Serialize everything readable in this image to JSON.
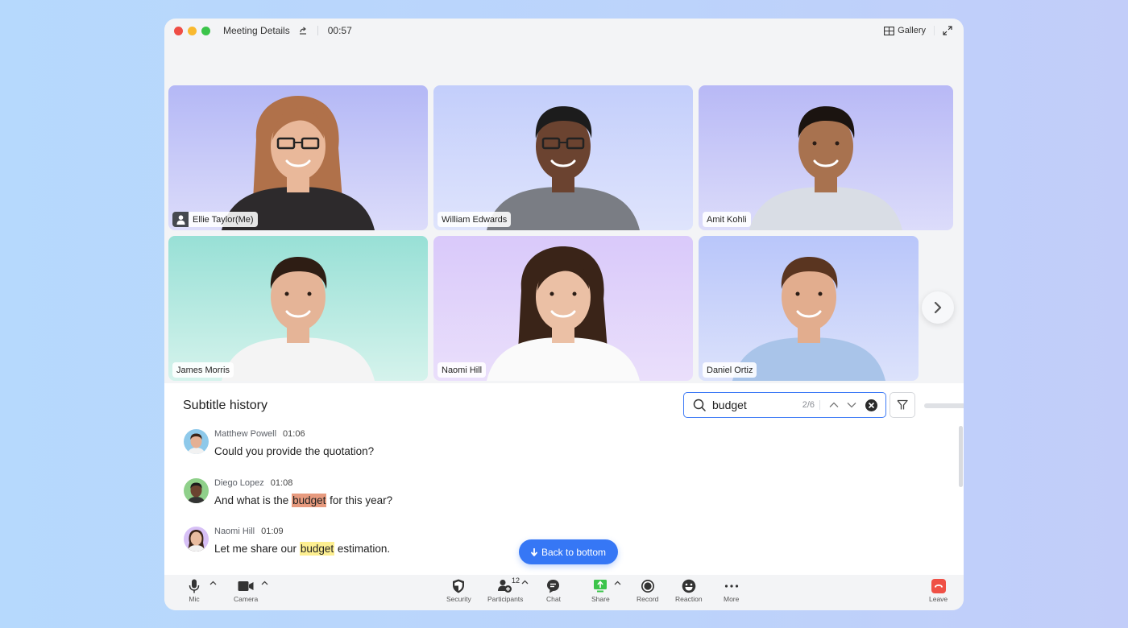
{
  "titlebar": {
    "title": "Meeting Details",
    "timer": "00:57",
    "view_label": "Gallery"
  },
  "participants": [
    {
      "name": "Ellie Taylor(Me)",
      "is_me": true,
      "bg_top": "#b4b8f6",
      "bg_bottom": "#dcdcfa"
    },
    {
      "name": "William Edwards",
      "is_me": false,
      "bg_top": "#c3cefb",
      "bg_bottom": "#dfe4fc"
    },
    {
      "name": "Amit Kohli",
      "is_me": false,
      "bg_top": "#b8b9f6",
      "bg_bottom": "#dcdcfa"
    },
    {
      "name": "James Morris",
      "is_me": false,
      "bg_top": "#98e0d6",
      "bg_bottom": "#d5f3ec"
    },
    {
      "name": "Naomi Hill",
      "is_me": false,
      "bg_top": "#d9c9fa",
      "bg_bottom": "#eadffb"
    },
    {
      "name": "Daniel Ortiz",
      "is_me": false,
      "bg_top": "#b9c6fa",
      "bg_bottom": "#dce2fb"
    }
  ],
  "subtitles": {
    "title": "Subtitle history",
    "search": {
      "value": "budget",
      "placeholder": "Search",
      "match_count": "2/6"
    },
    "entries": [
      {
        "speaker": "Matthew Powell",
        "time": "01:06",
        "before": "Could you provide the quotation?",
        "highlight": "",
        "after": "",
        "highlight_type": "none"
      },
      {
        "speaker": "Diego Lopez",
        "time": "01:08",
        "before": "And what is the ",
        "highlight": "budget",
        "after": " for this year?",
        "highlight_type": "current"
      },
      {
        "speaker": "Naomi Hill",
        "time": "01:09",
        "before": "Let me share our ",
        "highlight": "budget",
        "after": " estimation.",
        "highlight_type": "match"
      }
    ],
    "back_to_bottom": "Back to bottom"
  },
  "toolbar": {
    "mic": "Mic",
    "camera": "Camera",
    "security": "Security",
    "participants": "Participants",
    "participant_count": "12",
    "chat": "Chat",
    "share": "Share",
    "record": "Record",
    "reaction": "Reaction",
    "more": "More",
    "leave": "Leave"
  },
  "colors": {
    "accent": "#3677f5",
    "share_green": "#3bc44a",
    "leave_red": "#ef5046",
    "highlight_current": "#e79a7e",
    "highlight_match": "#fdef91"
  }
}
